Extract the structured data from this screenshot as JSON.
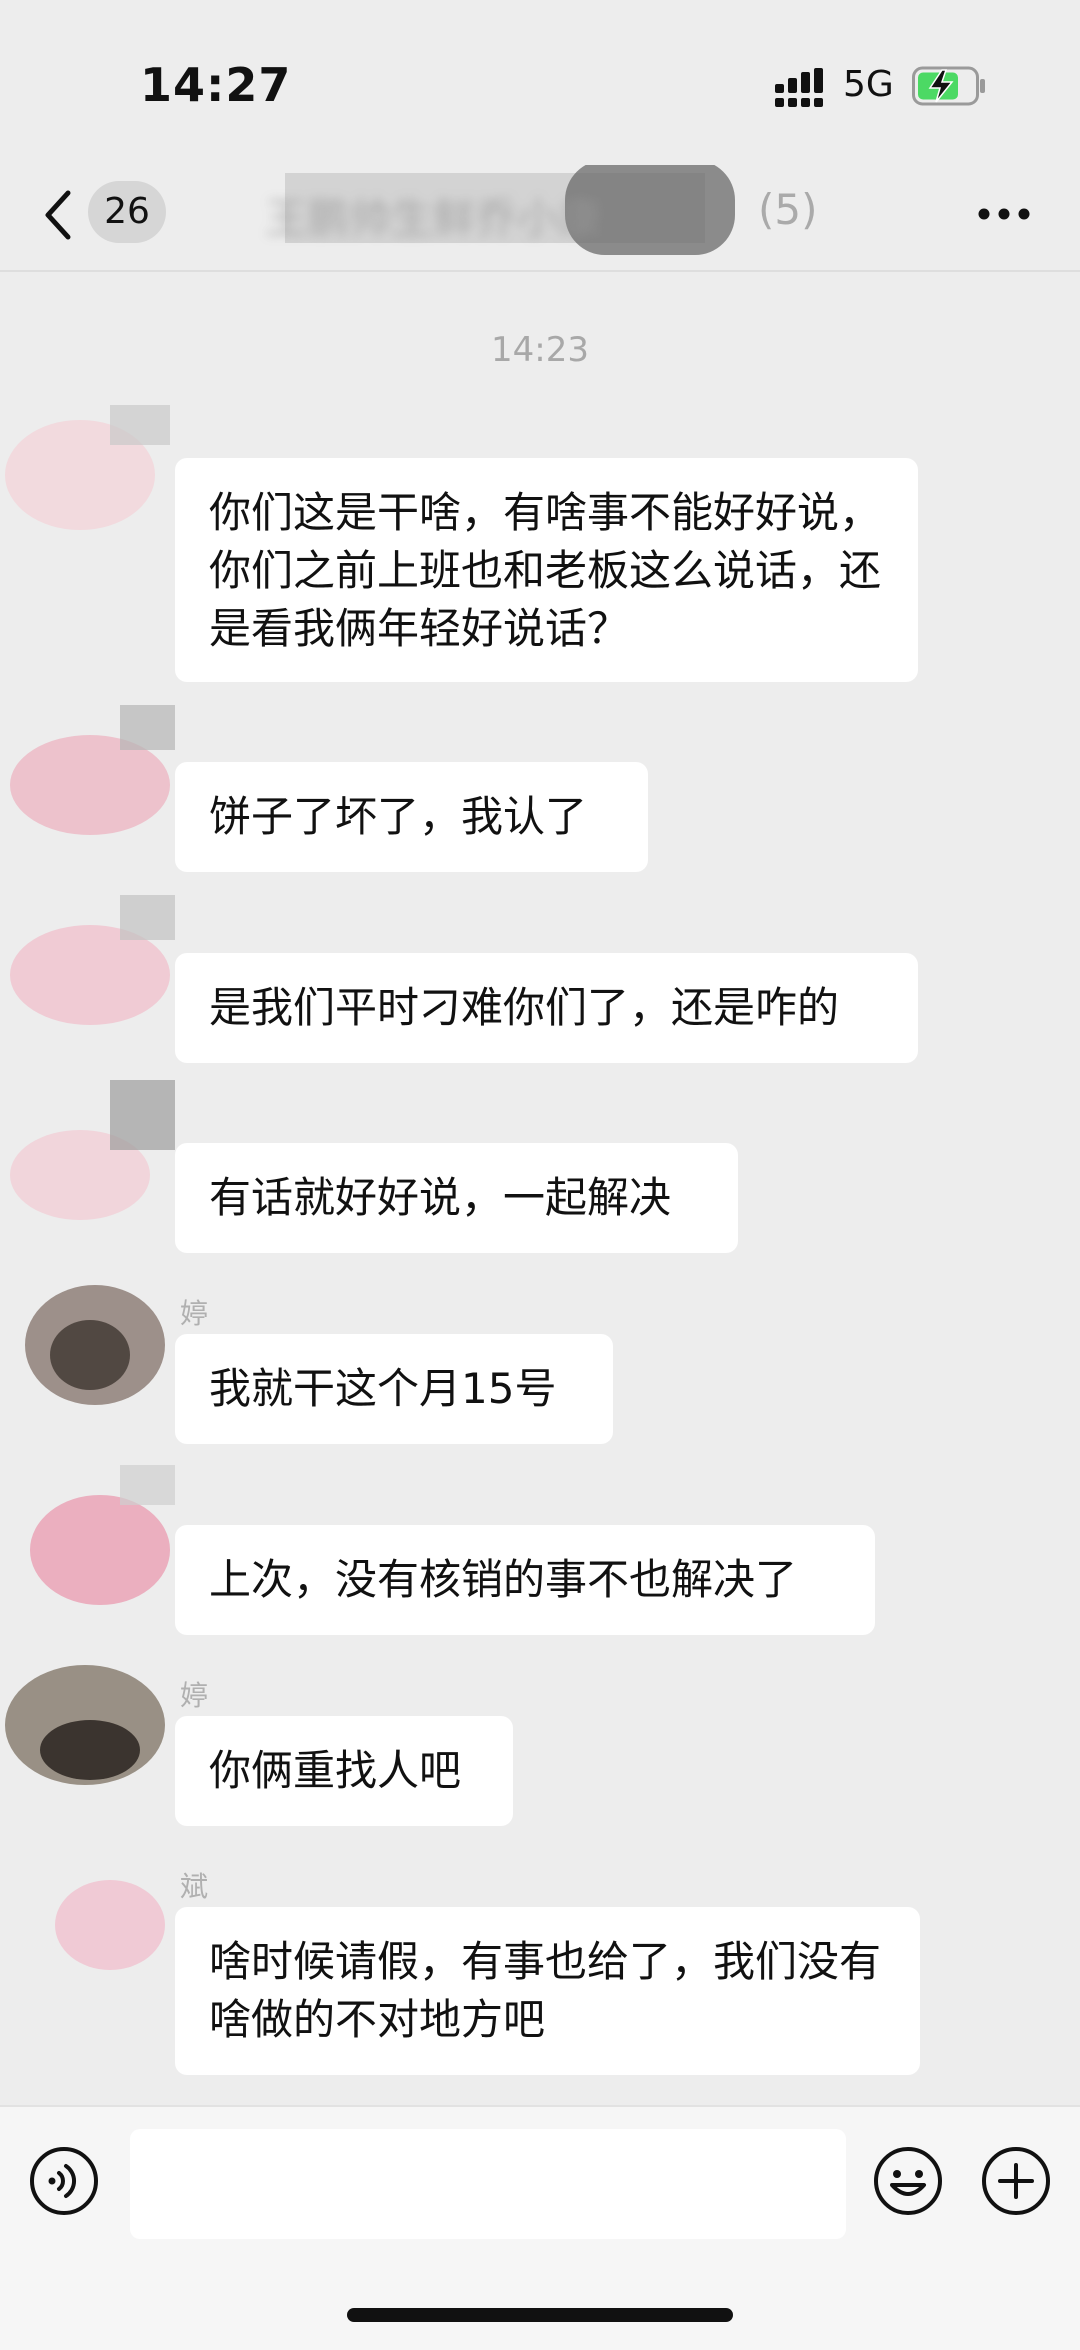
{
  "status_bar": {
    "time": "14:27",
    "network": "5G"
  },
  "nav": {
    "unread_count": "26",
    "group_title": "王鹏帅生鲜乔小康",
    "member_count": "(5)"
  },
  "chat": {
    "timestamp": "14:23",
    "messages": [
      {
        "sender": "",
        "text": "你们这是干啥，有啥事不能好好说，你们之前上班也和老板这么说话，还是看我俩年轻好说话？"
      },
      {
        "sender": "",
        "text": "饼子了坏了，我认了"
      },
      {
        "sender": "",
        "text": "是我们平时刁难你们了，还是咋的"
      },
      {
        "sender": "",
        "text": "有话就好好说，一起解决"
      },
      {
        "sender": "婷",
        "text": "我就干这个月15号"
      },
      {
        "sender": "",
        "text": "上次，没有核销的事不也解决了"
      },
      {
        "sender": "婷",
        "text": "你俩重找人吧"
      },
      {
        "sender": "斌",
        "text": "啥时候请假，有事也给了，我们没有啥做的不对地方吧"
      }
    ]
  },
  "input_bar": {
    "placeholder": ""
  },
  "icons": {
    "back": "chevron-left-icon",
    "more": "more-horizontal-icon",
    "voice": "voice-icon",
    "emoji": "emoji-icon",
    "plus": "plus-icon"
  },
  "colors": {
    "background": "#ededed",
    "bubble": "#ffffff",
    "battery": "#4cd964"
  }
}
